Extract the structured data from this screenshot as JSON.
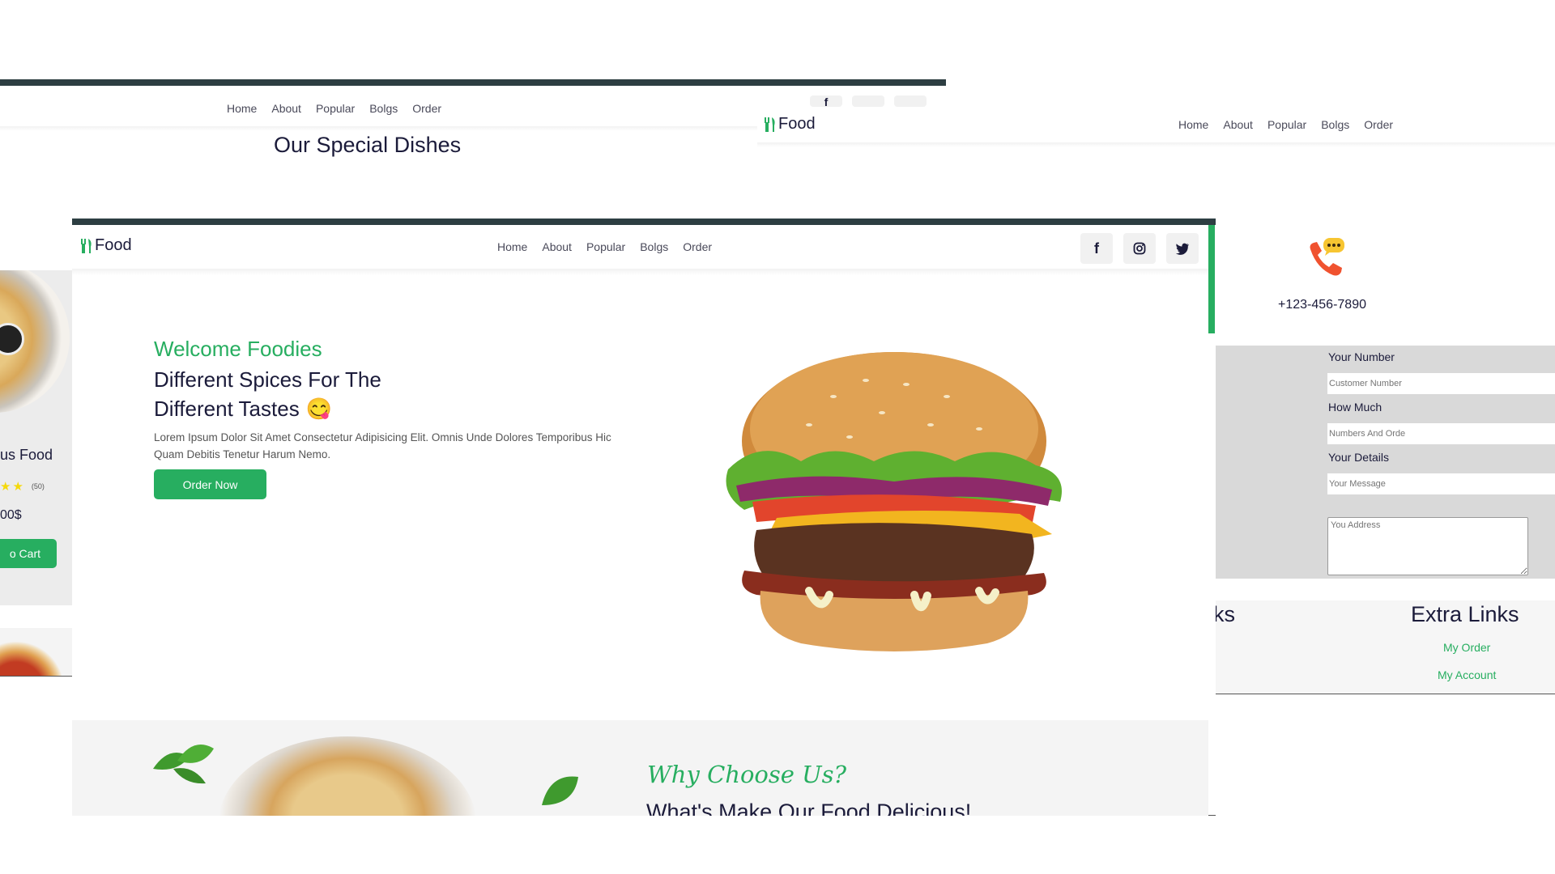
{
  "brand": {
    "name": "Food",
    "accent": "#27ae60",
    "dark": "#1b1b3a"
  },
  "nav": {
    "home": "Home",
    "about": "About",
    "popular": "Popular",
    "blogs": "Bolgs",
    "order": "Order"
  },
  "icons": {
    "logo": "fork-knife-icon",
    "facebook": "facebook-icon",
    "instagram": "instagram-icon",
    "twitter": "twitter-icon",
    "phone": "phone-chat-icon",
    "star": "star-icon"
  },
  "top_left_panel": {
    "section_title": "Our Special Dishes"
  },
  "left_panel": {
    "dish_name_partial": "us Food",
    "rating_count": "(50)",
    "price_partial": "00$",
    "cart_button_partial": "o Cart"
  },
  "hero": {
    "welcome": "Welcome Foodies",
    "heading_line1": "Different Spices For The",
    "heading_line2": "Different Tastes",
    "emoji": "😋",
    "description": "Lorem Ipsum Dolor Sit Amet Consectetur Adipisicing Elit. Omnis Unde Dolores Temporibus Hic Quam Debitis Tenetur Harum Nemo.",
    "cta": "Order Now"
  },
  "why": {
    "subtitle": "Why Choose Us?",
    "heading": "What's Make Our Food Delicious!"
  },
  "contact": {
    "phone": "+123-456-7890"
  },
  "order_form": {
    "number_label": "Your Number",
    "number_placeholder": "Customer Number",
    "how_much_label": "How Much",
    "how_much_placeholder": "Numbers And Orde",
    "details_label": "Your Details",
    "details_placeholder": "Your Message",
    "address_placeholder": "You Address"
  },
  "footer": {
    "links_partial": "ks",
    "extra_links_title": "Extra Links",
    "my_order": "My Order",
    "my_account": "My Account"
  }
}
